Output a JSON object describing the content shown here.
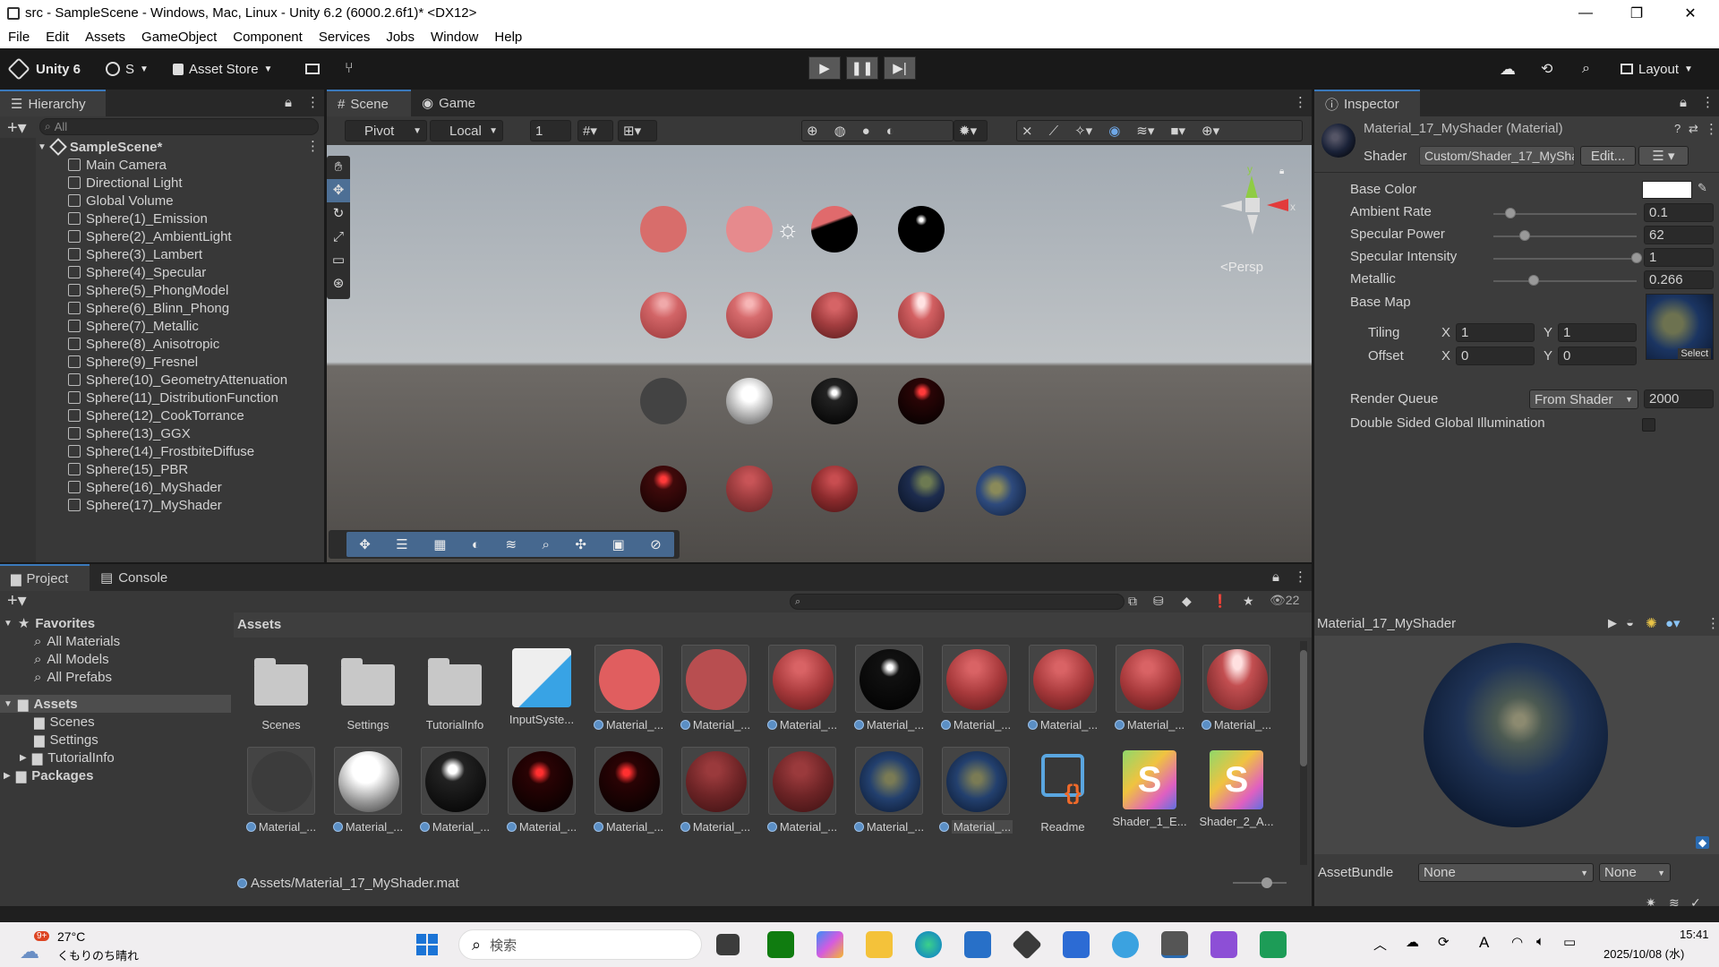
{
  "window": {
    "title": "src - SampleScene - Windows, Mac, Linux - Unity 6.2 (6000.2.6f1)* <DX12>",
    "controls": [
      "—",
      "❐",
      "✕"
    ]
  },
  "menu": [
    "File",
    "Edit",
    "Assets",
    "GameObject",
    "Component",
    "Services",
    "Jobs",
    "Window",
    "Help"
  ],
  "toolbar": {
    "unity_label": "Unity 6",
    "account_label": "S",
    "asset_store_label": "Asset Store",
    "layout_label": "Layout"
  },
  "hierarchy": {
    "tab": "Hierarchy",
    "search_placeholder": "All",
    "scene": "SampleScene*",
    "items": [
      "Main Camera",
      "Directional Light",
      "Global Volume",
      "Sphere(1)_Emission",
      "Sphere(2)_AmbientLight",
      "Sphere(3)_Lambert",
      "Sphere(4)_Specular",
      "Sphere(5)_PhongModel",
      "Sphere(6)_Blinn_Phong",
      "Sphere(7)_Metallic",
      "Sphere(8)_Anisotropic",
      "Sphere(9)_Fresnel",
      "Sphere(10)_GeometryAttenuation",
      "Sphere(11)_DistributionFunction",
      "Sphere(12)_CookTorrance",
      "Sphere(13)_GGX",
      "Sphere(14)_FrostbiteDiffuse",
      "Sphere(15)_PBR",
      "Sphere(16)_MyShader",
      "Sphere(17)_MyShader"
    ]
  },
  "scene": {
    "tabs": [
      "Scene",
      "Game"
    ],
    "pivot": "Pivot",
    "local": "Local",
    "grid_value": "1",
    "persp": "Persp",
    "gizmo_axes": {
      "y": "y",
      "x": "x"
    }
  },
  "inspector": {
    "tab": "Inspector",
    "material_name": "Material_17_MyShader (Material)",
    "shader_label": "Shader",
    "shader_value": "Custom/Shader_17_MyShar",
    "edit_label": "Edit...",
    "properties": [
      {
        "label": "Base Color"
      },
      {
        "label": "Ambient Rate",
        "value": "0.1",
        "fraction": 0.12
      },
      {
        "label": "Specular Power",
        "value": "62",
        "fraction": 0.22
      },
      {
        "label": "Specular Intensity",
        "value": "1",
        "fraction": 1.0
      },
      {
        "label": "Metallic",
        "value": "0.266",
        "fraction": 0.28
      }
    ],
    "base_map_label": "Base Map",
    "tiling_label": "Tiling",
    "offset_label": "Offset",
    "x_label": "X",
    "y_label": "Y",
    "tiling": {
      "x": "1",
      "y": "1"
    },
    "offset": {
      "x": "0",
      "y": "0"
    },
    "select_label": "Select",
    "render_queue_label": "Render Queue",
    "render_queue_mode": "From Shader",
    "render_queue_value": "2000",
    "double_sided_label": "Double Sided Global Illumination",
    "preview_title": "Material_17_MyShader",
    "assetbundle_label": "AssetBundle",
    "assetbundle_value": "None",
    "assetbundle_variant": "None"
  },
  "project": {
    "tabs": [
      "Project",
      "Console"
    ],
    "favorites_label": "Favorites",
    "favorites": [
      "All Materials",
      "All Models",
      "All Prefabs"
    ],
    "assets_label": "Assets",
    "asset_folders": [
      "Scenes",
      "Settings",
      "TutorialInfo"
    ],
    "packages_label": "Packages",
    "breadcrumb": "Assets",
    "count": "22",
    "row1": [
      "Scenes",
      "Settings",
      "TutorialInfo",
      "InputSyste...",
      "Material_...",
      "Material_...",
      "Material_...",
      "Material_...",
      "Material_...",
      "Material_...",
      "Material_...",
      "Material_..."
    ],
    "row2": [
      "Material_...",
      "Material_...",
      "Material_...",
      "Material_...",
      "Material_...",
      "Material_...",
      "Material_...",
      "Material_...",
      "Material_...",
      "Readme",
      "Shader_1_E...",
      "Shader_2_A..."
    ],
    "status_path": "Assets/Material_17_MyShader.mat"
  },
  "taskbar": {
    "weather_temp": "27°C",
    "weather_text": "くもりのち晴れ",
    "weather_badge": "9+",
    "search_placeholder": "検索",
    "time": "15:41",
    "date": "2025/10/08 (水)",
    "ime": "A"
  }
}
